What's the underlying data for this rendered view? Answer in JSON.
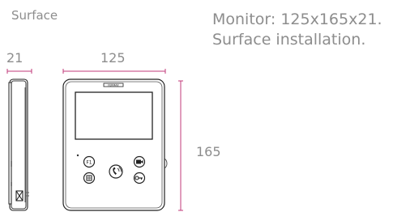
{
  "section_label": "Surface",
  "dimensions": {
    "depth": "21",
    "width": "125",
    "height": "165"
  },
  "description": {
    "line1": "Monitor: 125x165x21.",
    "line2": "Surface installation."
  },
  "device": {
    "brand": "FERMAX"
  },
  "colors": {
    "dimension_line": "#c0397a",
    "outline": "#222222",
    "text": "#8d8d8d"
  },
  "icons": [
    "f1-button-icon",
    "home-button-icon",
    "talk-button-icon",
    "camera-button-icon",
    "key-button-icon"
  ]
}
